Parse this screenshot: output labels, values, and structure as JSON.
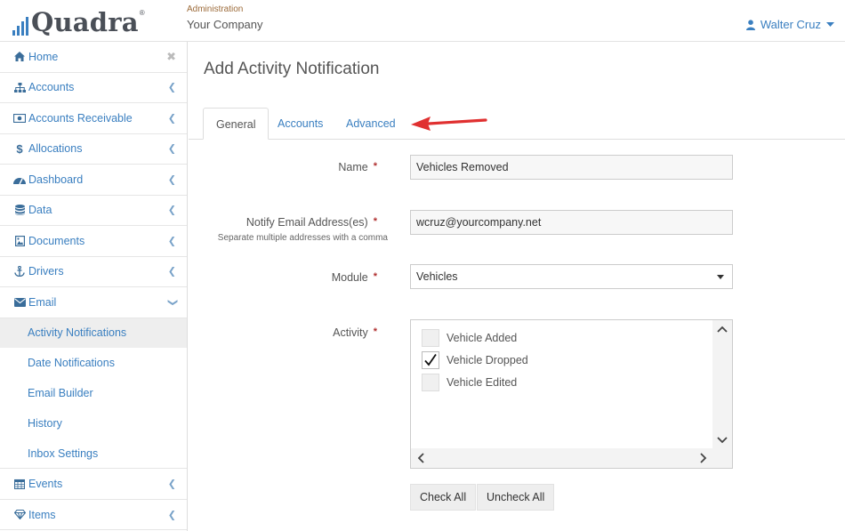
{
  "header": {
    "logo_text": "Quadra",
    "logo_reg": "®",
    "admin_label": "Administration",
    "company": "Your Company",
    "user_name": "Walter Cruz"
  },
  "sidebar": {
    "items": [
      {
        "label": "Home",
        "icon": "home-icon"
      },
      {
        "label": "Accounts",
        "icon": "sitemap-icon"
      },
      {
        "label": "Accounts Receivable",
        "icon": "money-icon"
      },
      {
        "label": "Allocations",
        "icon": "dollar-icon"
      },
      {
        "label": "Dashboard",
        "icon": "dashboard-icon"
      },
      {
        "label": "Data",
        "icon": "database-icon"
      },
      {
        "label": "Documents",
        "icon": "image-file-icon"
      },
      {
        "label": "Drivers",
        "icon": "anchor-icon"
      },
      {
        "label": "Email",
        "icon": "envelope-icon"
      }
    ],
    "email_sub": [
      {
        "label": "Activity Notifications",
        "active": true
      },
      {
        "label": "Date Notifications"
      },
      {
        "label": "Email Builder"
      },
      {
        "label": "History"
      },
      {
        "label": "Inbox Settings"
      }
    ],
    "bottom_items": [
      {
        "label": "Events",
        "icon": "calendar-icon"
      },
      {
        "label": "Items",
        "icon": "diamond-icon"
      }
    ]
  },
  "main": {
    "title": "Add Activity Notification",
    "tabs": [
      {
        "label": "General",
        "active": true
      },
      {
        "label": "Accounts"
      },
      {
        "label": "Advanced"
      }
    ],
    "form": {
      "name_label": "Name",
      "name_value": "Vehicles Removed",
      "email_label": "Notify Email Address(es)",
      "email_help": "Separate multiple addresses with a comma",
      "email_value": "wcruz@yourcompany.net",
      "module_label": "Module",
      "module_value": "Vehicles",
      "activity_label": "Activity",
      "activities": [
        {
          "label": "Vehicle Added",
          "checked": false
        },
        {
          "label": "Vehicle Dropped",
          "checked": true
        },
        {
          "label": "Vehicle Edited",
          "checked": false
        }
      ],
      "check_all": "Check All",
      "uncheck_all": "Uncheck All"
    }
  },
  "colors": {
    "link": "#3a7fc0",
    "required": "#b03030",
    "annotation_arrow": "#e03030"
  }
}
